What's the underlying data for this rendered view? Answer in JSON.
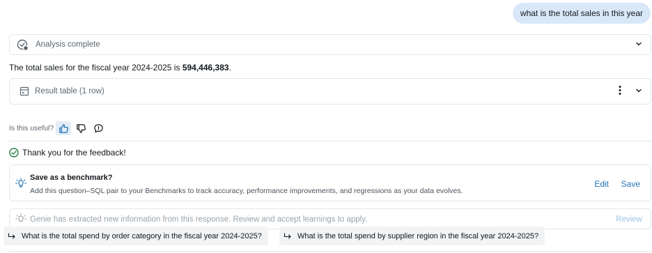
{
  "user_message": "what is the total sales in this year",
  "analysis": {
    "label": "Analysis complete"
  },
  "answer": {
    "prefix": "The total sales for the fiscal year 2024-2025 is ",
    "value": "594,446,383",
    "suffix": "."
  },
  "result_table": {
    "label": "Result table (1 row)"
  },
  "feedback": {
    "question": "Is this useful?",
    "thanks": "Thank you for the feedback!"
  },
  "benchmark": {
    "title": "Save as a benchmark?",
    "description": "Add this question–SQL pair to your Benchmarks to track accuracy, performance improvements, and regressions as your data evolves.",
    "edit_label": "Edit",
    "save_label": "Save"
  },
  "genie": {
    "text": "Genie has extracted new information from this response. Review and accept learnings to apply.",
    "review_label": "Review"
  },
  "suggestions": [
    "What is the total spend by order category in the fiscal year 2024-2025?",
    "What is the total spend by supplier region in the fiscal year 2024-2025?"
  ],
  "colors": {
    "accent": "#2272b4",
    "user_bubble": "#d9e8f8",
    "success": "#277c43",
    "border": "#e3e6ea"
  }
}
